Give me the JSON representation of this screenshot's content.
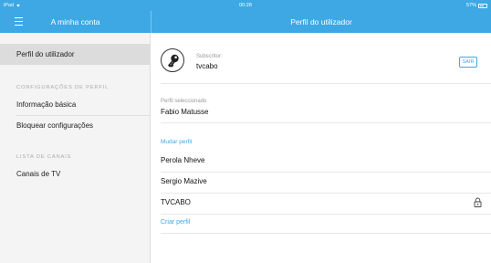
{
  "status_bar": {
    "carrier": "iPad",
    "time": "00:28",
    "battery": "57%"
  },
  "header": {
    "left_title": "A minha conta",
    "right_title": "Perfil do utilizador"
  },
  "sidebar": {
    "items": [
      {
        "label": "Perfil do utilizador",
        "active": true
      },
      {
        "label": "Informação básica"
      },
      {
        "label": "Bloquear configurações"
      },
      {
        "label": "Canais de TV"
      }
    ],
    "sections": [
      "CONFIGURAÇÕES DE PERFIL",
      "LISTA DE CANAIS"
    ]
  },
  "main": {
    "subscriber_label": "Subscritor:",
    "subscriber_value": "tvcabo",
    "logout_label": "SAIR",
    "selected_profile_label": "Perfil seleccionado",
    "selected_profile_value": "Fabio Matusse",
    "change_profile_label": "Mudar perfil",
    "profiles": [
      {
        "name": "Perola Nheve",
        "locked": false
      },
      {
        "name": "Sergio Mazive",
        "locked": false
      },
      {
        "name": "TVCABO",
        "locked": true
      }
    ],
    "create_profile_label": "Criar perfil"
  },
  "colors": {
    "accent": "#3da8e4",
    "sidebar_bg": "#f4f4f4",
    "active_item_bg": "#dcdcdc"
  },
  "icons": [
    "menu-icon",
    "wifi-icon",
    "battery-icon",
    "key-icon",
    "lock-icon"
  ]
}
